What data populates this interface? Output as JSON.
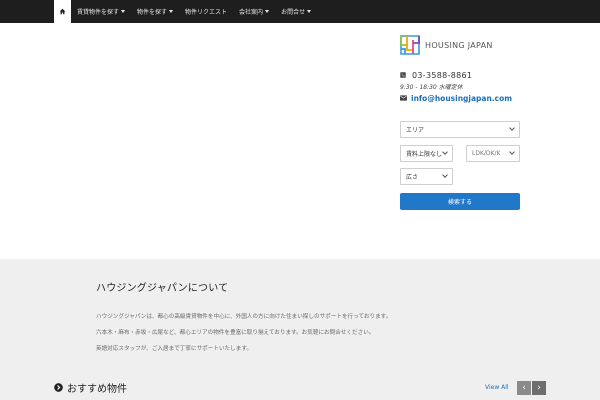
{
  "nav": {
    "items": [
      {
        "label": "賃貸物件を探す",
        "dropdown": true
      },
      {
        "label": "物件を探す",
        "dropdown": true
      },
      {
        "label": "物件リクエスト",
        "dropdown": false
      },
      {
        "label": "会社案内",
        "dropdown": true
      },
      {
        "label": "お問合せ",
        "dropdown": true
      }
    ]
  },
  "sidebar": {
    "logo_text": "HOUSING JAPAN",
    "phone": "03-3588-8861",
    "hours": "9:30 - 18:30 水曜定休",
    "email": "info@housingjapan.com",
    "search": {
      "area": "エリア",
      "rent": "賃料上限なし",
      "layout": "LDK/DK/K",
      "size": "広さ",
      "button": "検索する"
    }
  },
  "about": {
    "title": "ハウジングジャパンについて",
    "lines": [
      "ハウジングジャパンは、都心の高級賃貸物件を中心に、外国人の方に向けた住まい探しのサポートを行っております。",
      "六本木・麻布・赤坂・広尾など、都心エリアの物件を豊富に取り揃えております。お気軽にお問合せください。",
      "英語対応スタッフが、ご入居まで丁寧にサポートいたします。"
    ]
  },
  "featured": {
    "title": "おすすめ物件",
    "view_all": "View All"
  },
  "colors": {
    "nav_bg": "#1e1e1e",
    "accent": "#2178c9",
    "section_bg": "#efefef"
  }
}
